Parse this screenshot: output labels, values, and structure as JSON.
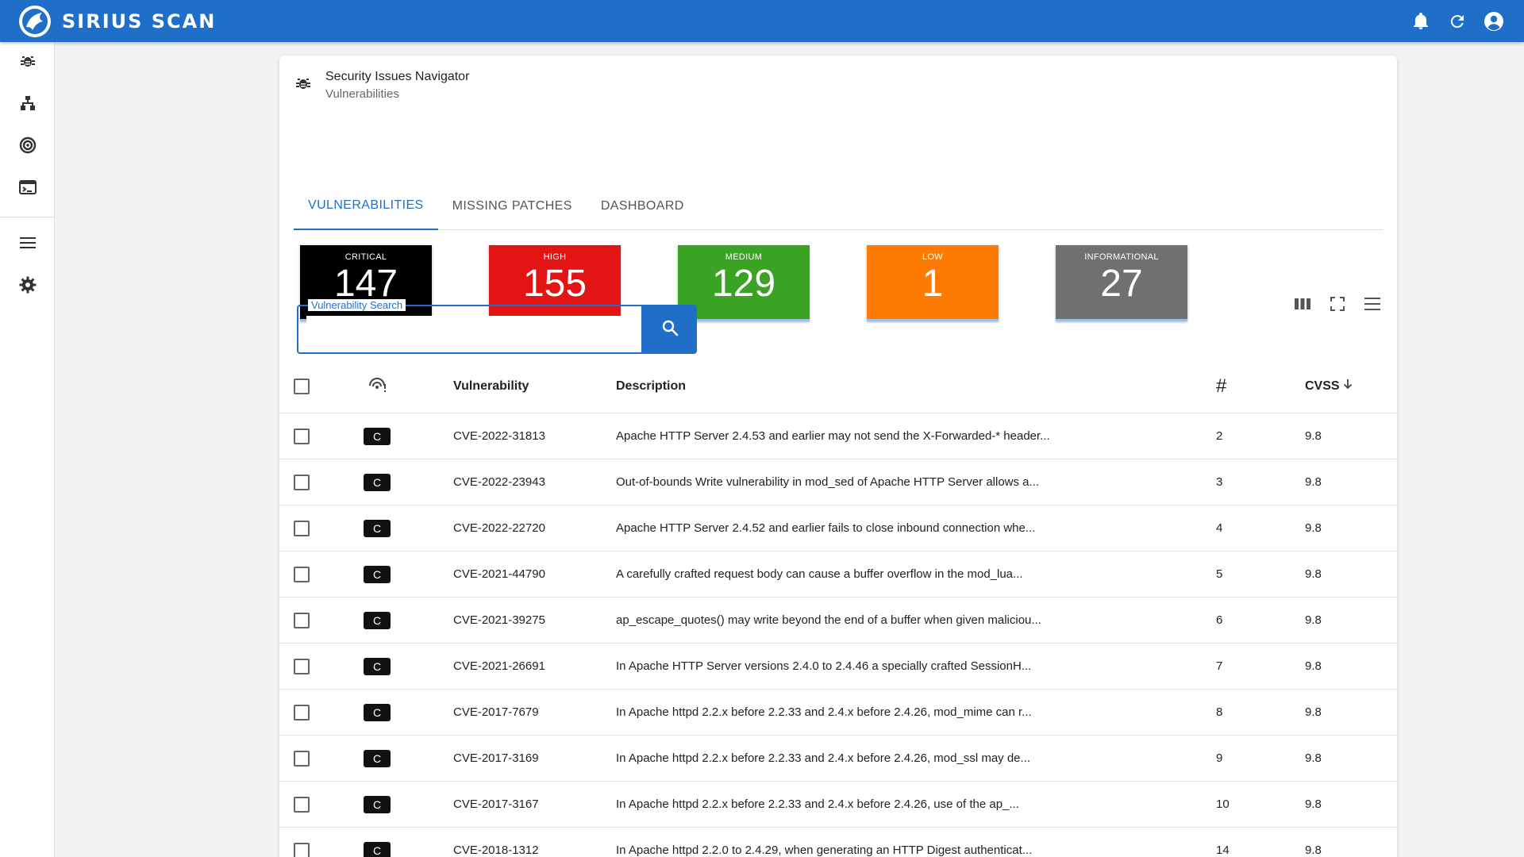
{
  "app": {
    "brand": "SIRIUS SCAN"
  },
  "header": {
    "title": "Security Issues Navigator",
    "subtitle": "Vulnerabilities"
  },
  "tabs": [
    {
      "label": "VULNERABILITIES",
      "active": true
    },
    {
      "label": "MISSING PATCHES",
      "active": false
    },
    {
      "label": "DASHBOARD",
      "active": false
    }
  ],
  "severity": [
    {
      "label": "CRITICAL",
      "count": "147",
      "color": "#000000"
    },
    {
      "label": "HIGH",
      "count": "155",
      "color": "#e21414"
    },
    {
      "label": "MEDIUM",
      "count": "129",
      "color": "#3aa324"
    },
    {
      "label": "LOW",
      "count": "1",
      "color": "#ff7a00"
    },
    {
      "label": "INFORMATIONAL",
      "count": "27",
      "color": "#707070"
    }
  ],
  "search": {
    "label": "Vulnerability Search",
    "value": ""
  },
  "table": {
    "headers": {
      "vulnerability": "Vulnerability",
      "description": "Description",
      "count": "#",
      "cvss": "CVSS"
    },
    "rows": [
      {
        "sev": "C",
        "id": "CVE-2022-31813",
        "desc": "Apache HTTP Server 2.4.53 and earlier may not send the X-Forwarded-* header...",
        "count": "2",
        "cvss": "9.8"
      },
      {
        "sev": "C",
        "id": "CVE-2022-23943",
        "desc": "Out-of-bounds Write vulnerability in mod_sed of Apache HTTP Server allows a...",
        "count": "3",
        "cvss": "9.8"
      },
      {
        "sev": "C",
        "id": "CVE-2022-22720",
        "desc": "Apache HTTP Server 2.4.52 and earlier fails to close inbound connection whe...",
        "count": "4",
        "cvss": "9.8"
      },
      {
        "sev": "C",
        "id": "CVE-2021-44790",
        "desc": "A carefully crafted request body can cause a buffer overflow in the mod_lua...",
        "count": "5",
        "cvss": "9.8"
      },
      {
        "sev": "C",
        "id": "CVE-2021-39275",
        "desc": "ap_escape_quotes() may write beyond the end of a buffer when given maliciou...",
        "count": "6",
        "cvss": "9.8"
      },
      {
        "sev": "C",
        "id": "CVE-2021-26691",
        "desc": "In Apache HTTP Server versions 2.4.0 to 2.4.46 a specially crafted SessionH...",
        "count": "7",
        "cvss": "9.8"
      },
      {
        "sev": "C",
        "id": "CVE-2017-7679",
        "desc": "In Apache httpd 2.2.x before 2.2.33 and 2.4.x before 2.4.26, mod_mime can r...",
        "count": "8",
        "cvss": "9.8"
      },
      {
        "sev": "C",
        "id": "CVE-2017-3169",
        "desc": "In Apache httpd 2.2.x before 2.2.33 and 2.4.x before 2.4.26, mod_ssl may de...",
        "count": "9",
        "cvss": "9.8"
      },
      {
        "sev": "C",
        "id": "CVE-2017-3167",
        "desc": "In Apache httpd 2.2.x before 2.2.33 and 2.4.x before 2.4.26, use of the ap_...",
        "count": "10",
        "cvss": "9.8"
      },
      {
        "sev": "C",
        "id": "CVE-2018-1312",
        "desc": "In Apache httpd 2.2.0 to 2.4.29, when generating an HTTP Digest authenticat...",
        "count": "14",
        "cvss": "9.8"
      }
    ]
  }
}
